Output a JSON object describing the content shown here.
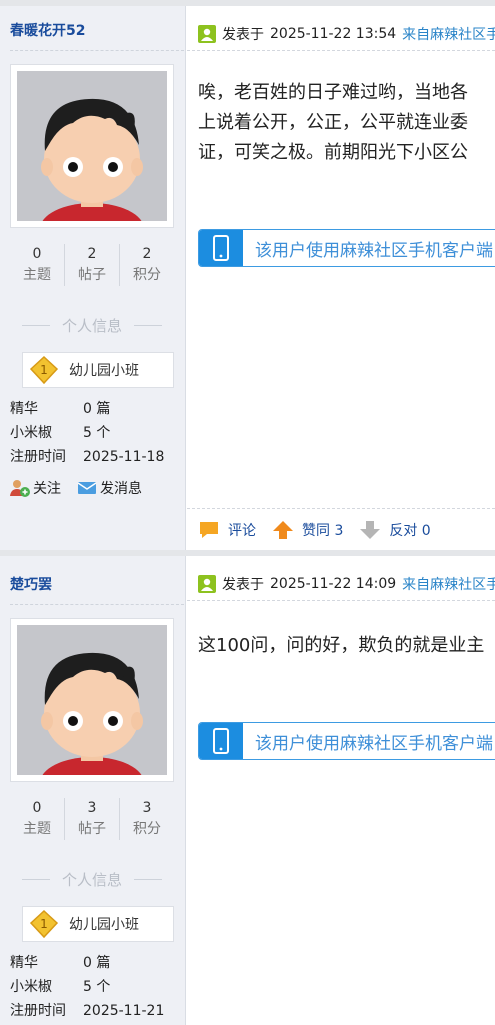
{
  "posts": [
    {
      "username": "春暖花开52",
      "stats": [
        {
          "num": "0",
          "label": "主题"
        },
        {
          "num": "2",
          "label": "帖子"
        },
        {
          "num": "2",
          "label": "积分"
        }
      ],
      "section_title": "个人信息",
      "level": "幼儿园小班",
      "level_badge": "1",
      "info": [
        {
          "k": "精华",
          "v": "0 篇"
        },
        {
          "k": "小米椒",
          "v": "5 个"
        },
        {
          "k": "注册时间",
          "v": "2025-11-18"
        }
      ],
      "follow_label": "关注",
      "message_label": "发消息",
      "meta_prefix": "发表于",
      "meta_time": "2025-11-22 13:54",
      "meta_source": "来自麻辣社区手",
      "body_lines": [
        "唉，老百姓的日子难过哟，当地各",
        "上说着公开，公正，公平就连业委",
        "证，可笑之极。前期阳光下小区公"
      ],
      "mobile_text": "该用户使用麻辣社区手机客户端",
      "comment_label": "评论",
      "like_label": "赞同 3",
      "oppose_label": "反对 0"
    },
    {
      "username": "楚巧罢",
      "stats": [
        {
          "num": "0",
          "label": "主题"
        },
        {
          "num": "3",
          "label": "帖子"
        },
        {
          "num": "3",
          "label": "积分"
        }
      ],
      "section_title": "个人信息",
      "level": "幼儿园小班",
      "level_badge": "1",
      "info": [
        {
          "k": "精华",
          "v": "0 篇"
        },
        {
          "k": "小米椒",
          "v": "5 个"
        },
        {
          "k": "注册时间",
          "v": "2025-11-21"
        }
      ],
      "meta_prefix": "发表于",
      "meta_time": "2025-11-22 14:09",
      "meta_source": "来自麻辣社区手",
      "body_lines": [
        "这100问，问的好，欺负的就是业主"
      ],
      "mobile_text": "该用户使用麻辣社区手机客户端"
    }
  ]
}
